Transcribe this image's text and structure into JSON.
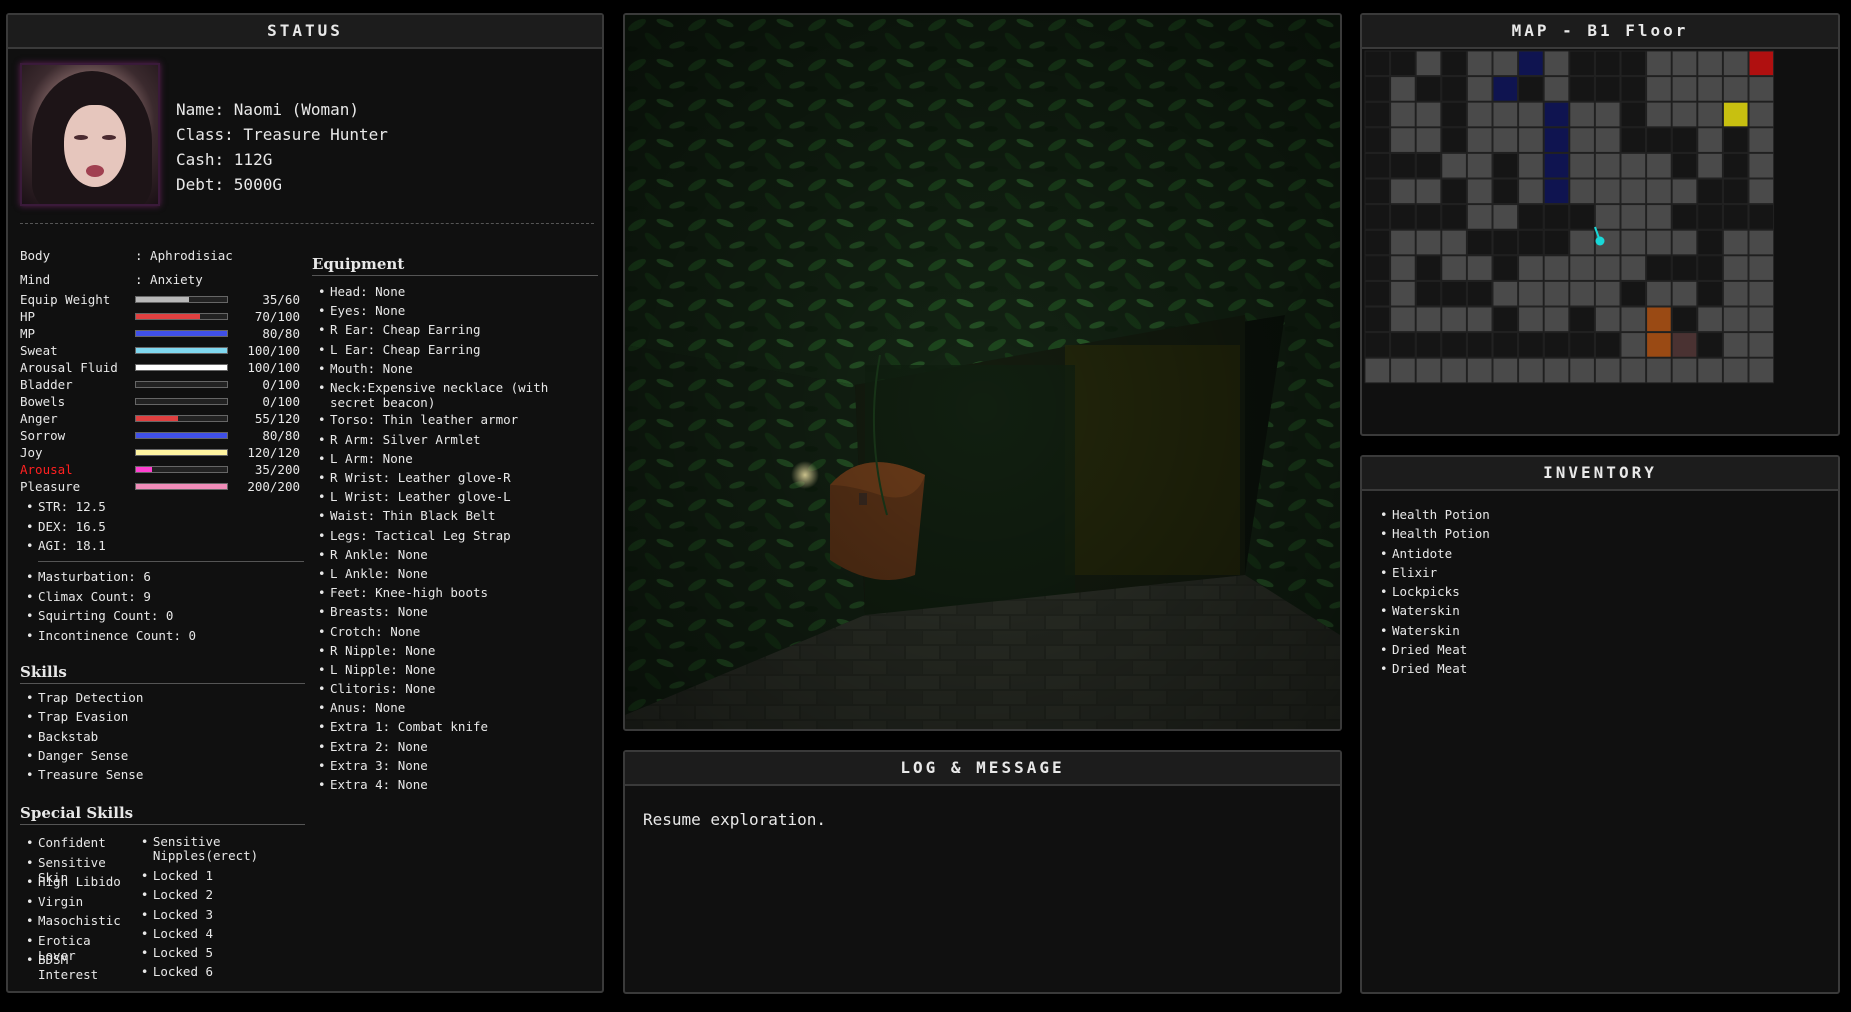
{
  "status": {
    "title": "STATUS",
    "name": "Name: Naomi (Woman)",
    "class": "Class: Treasure Hunter",
    "cash": "Cash: 112G",
    "debt": "Debt: 5000G",
    "body_label": "Body",
    "body_value": ": Aphrodisiac",
    "mind_label": "Mind",
    "mind_value": ": Anxiety",
    "bars": [
      {
        "label": "Equip Weight",
        "value": "35/60",
        "pct": 0.583,
        "color": "#b8b8b8"
      },
      {
        "label": "HP",
        "value": "70/100",
        "pct": 0.7,
        "color": "#e04040"
      },
      {
        "label": "MP",
        "value": "80/80",
        "pct": 1.0,
        "color": "#4050e8"
      },
      {
        "label": "Sweat",
        "value": "100/100",
        "pct": 1.0,
        "color": "#80d8f0"
      },
      {
        "label": "Arousal Fluid",
        "value": "100/100",
        "pct": 1.0,
        "color": "#ffffff"
      },
      {
        "label": "Bladder",
        "value": "0/100",
        "pct": 0.0,
        "color": "#888888"
      },
      {
        "label": "Bowels",
        "value": "0/100",
        "pct": 0.0,
        "color": "#888888"
      },
      {
        "label": "Anger",
        "value": "55/120",
        "pct": 0.458,
        "color": "#e04040"
      },
      {
        "label": "Sorrow",
        "value": "80/80",
        "pct": 1.0,
        "color": "#4050e8"
      },
      {
        "label": "Joy",
        "value": "120/120",
        "pct": 1.0,
        "color": "#fff4a0"
      },
      {
        "label": "Arousal",
        "value": "35/200",
        "pct": 0.175,
        "color": "#ff40d0",
        "label_color": "#ff2020"
      },
      {
        "label": "Pleasure",
        "value": "200/200",
        "pct": 1.0,
        "color": "#f08cb8"
      }
    ],
    "attributes": [
      "STR: 12.5",
      "DEX: 16.5",
      "AGI: 18.1"
    ],
    "counts": [
      "Masturbation: 6",
      "Climax Count: 9",
      "Squirting Count: 0",
      "Incontinence Count: 0"
    ],
    "skills_title": "Skills",
    "skills": [
      "Trap Detection",
      "Trap Evasion",
      "Backstab",
      "Danger Sense",
      "Treasure Sense"
    ],
    "special_title": "Special Skills",
    "special_col1": [
      "Confident",
      "Sensitive Skin",
      "High Libido",
      "Virgin",
      "Masochistic",
      "Erotica Lover",
      "BDSM Interest"
    ],
    "special_col2": [
      "Sensitive Nipples(erect)",
      "Locked 1",
      "Locked 2",
      "Locked 3",
      "Locked 4",
      "Locked 5",
      "Locked 6"
    ],
    "equipment_title": "Equipment",
    "equipment": [
      "Head: None",
      "Eyes: None",
      "R Ear: Cheap Earring",
      "L Ear: Cheap Earring",
      "Mouth: None",
      "Neck:Expensive necklace (with secret beacon)",
      "Torso: Thin leather armor",
      "R Arm: Silver Armlet",
      "L Arm: None",
      "R Wrist: Leather glove-R",
      "L Wrist: Leather glove-L",
      "Waist: Thin Black Belt",
      "Legs: Tactical Leg Strap",
      "R Ankle: None",
      "L Ankle: None",
      "Feet: Knee-high boots",
      "Breasts: None",
      "Crotch: None",
      "R Nipple: None",
      "L Nipple: None",
      "Clitoris: None",
      "Anus: None",
      "Extra 1: Combat knife",
      "Extra 2: None",
      "Extra 3: None",
      "Extra 4: None"
    ]
  },
  "log": {
    "title": "LOG & MESSAGE",
    "message": "Resume exploration."
  },
  "map": {
    "title": "MAP - B1 Floor"
  },
  "inventory": {
    "title": "INVENTORY",
    "items": [
      "Health Potion",
      "Health Potion",
      "Antidote",
      "Elixir",
      "Lockpicks",
      "Waterskin",
      "Waterskin",
      "Dried Meat",
      "Dried Meat"
    ]
  }
}
